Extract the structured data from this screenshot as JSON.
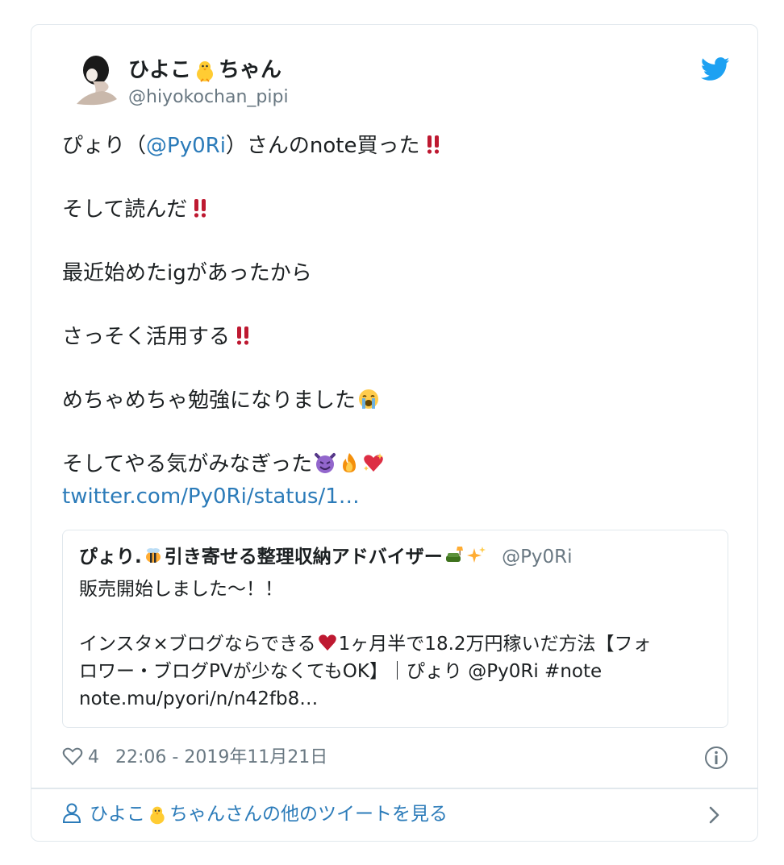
{
  "author": {
    "name_part1": "ひよこ",
    "name_part2": "ちゃん",
    "handle": "@hiyokochan_pipi"
  },
  "tweet": {
    "line1_pre": "ぴょり（",
    "line1_mention": "@Py0Ri",
    "line1_post": "）さんのnote買った",
    "line2": "そして読んだ",
    "line3": "最近始めたigがあったから",
    "line4": "さっそく活用する",
    "line5": "めちゃめちゃ勉強になりました",
    "line6": "そしてやる気がみなぎった",
    "link": "twitter.com/Py0Ri/status/1…"
  },
  "quoted": {
    "name": "ぴょり.",
    "name_rest": "引き寄せる整理収納アドバイザー",
    "handle": "@Py0Ri",
    "line1": "販売開始しました〜！！",
    "line2_pre": "インスタ×ブログならできる",
    "line2_post": "1ヶ月半で18.2万円稼いだ方法【フォ",
    "line3": "ロワー・ブログPVが少なくてもOK】｜ぴょり @Py0Ri #note",
    "line4": "note.mu/pyori/n/n42fb8…"
  },
  "meta": {
    "likes": "4",
    "timestamp": "22:06 - 2019年11月21日"
  },
  "footer": {
    "pre": "ひよこ",
    "post": "ちゃんさんの他のツイートを見る"
  },
  "colors": {
    "link": "#2b7bb9",
    "secondary_text": "#697882",
    "border": "#e1e8ed",
    "twitter_blue": "#1da1f2"
  },
  "icons": [
    "avatar",
    "chick-icon",
    "twitter-bird-icon",
    "double-exclamation-icon",
    "crying-face-icon",
    "smiling-imp-icon",
    "fire-icon",
    "sparkling-heart-icon",
    "bee-icon",
    "couch-lamp-icon",
    "sparkles-icon",
    "red-heart-icon",
    "heart-outline-icon",
    "info-icon",
    "person-icon",
    "chevron-right-icon"
  ]
}
